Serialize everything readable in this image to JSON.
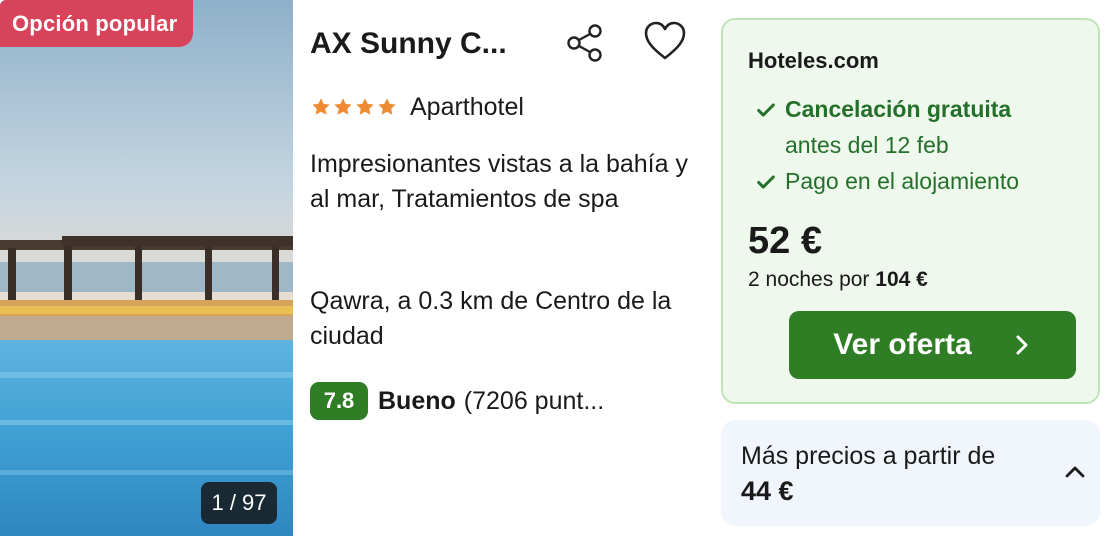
{
  "listing": {
    "badge": "Opción popular",
    "photo_counter": "1 / 97",
    "name": "AX Sunny C...",
    "star_rating": 4,
    "type": "Aparthotel",
    "description": "Impresionantes vistas a la bahía y al mar, Tratamientos de spa",
    "location": "Qawra, a 0.3 km de Centro de la ciudad",
    "rating": {
      "score": "7.8",
      "label": "Bueno",
      "count": "(7206 punt..."
    },
    "icons": {
      "share": "share-icon",
      "favorite": "heart-icon",
      "star": "star-icon"
    }
  },
  "offer": {
    "provider": "Hoteles.com",
    "free_cancel": "Cancelación gratuita",
    "free_cancel_until": "antes del 12 feb",
    "pay_at_property": "Pago en el alojamiento",
    "price": "52 €",
    "total_prefix": "2 noches por",
    "total_amount": "104 €",
    "cta": "Ver oferta"
  },
  "more_prices": {
    "label": "Más precios a partir de",
    "price": "44 €"
  },
  "colors": {
    "badge": "#d7435a",
    "brand_green": "#2f7d24",
    "offer_bg": "#eef8ec",
    "offer_border": "#bfe5b7",
    "star": "#ef8b34",
    "more_bg": "#f1f6fc"
  }
}
